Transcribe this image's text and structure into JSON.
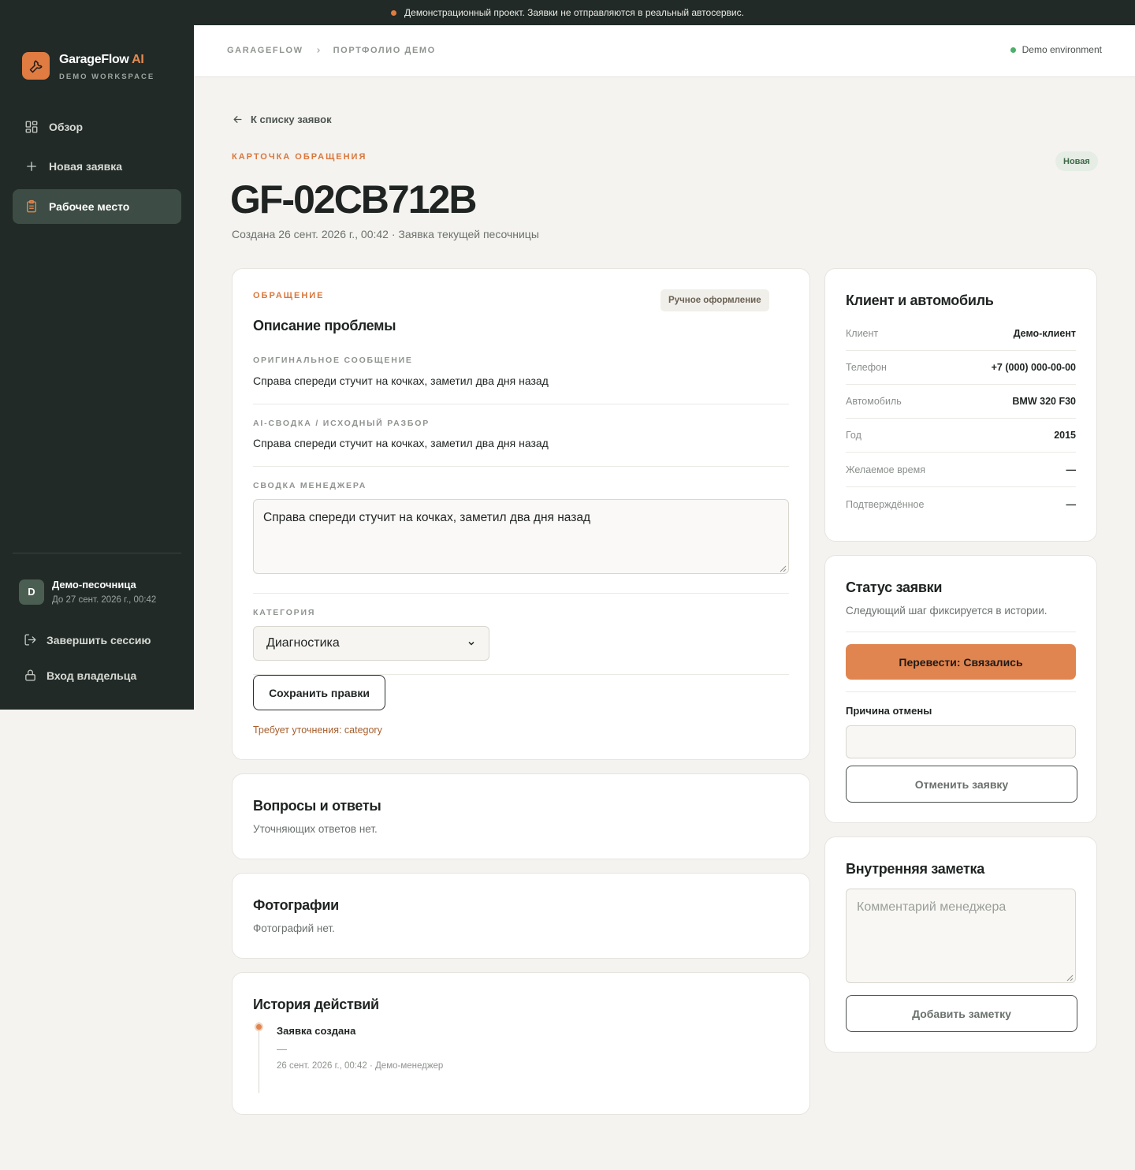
{
  "banner": {
    "text": "Демонстрационный проект. Заявки не отправляются в реальный автосервис."
  },
  "brand": {
    "name": "GarageFlow",
    "name_ai": "AI",
    "subtitle": "DEMO WORKSPACE",
    "icon": "wrench-icon"
  },
  "nav": {
    "overview": "Обзор",
    "new_request": "Новая заявка",
    "workspace": "Рабочее место"
  },
  "user": {
    "initial": "D",
    "name": "Демо-песочница",
    "expires": "До 27 сент. 2026 г., 00:42",
    "end_session": "Завершить сессию",
    "owner_login": "Вход владельца"
  },
  "breadcrumb": {
    "root": "GARAGEFLOW",
    "current": "ПОРТФОЛИО ДЕМО"
  },
  "environment": {
    "label": "Demo environment",
    "color": "#4caf6a"
  },
  "back_link": "К списку заявок",
  "page": {
    "eyebrow": "КАРТОЧКА ОБРАЩЕНИЯ",
    "id": "GF-02CB712B",
    "meta": "Создана 26 сент. 2026 г., 00:42 · Заявка текущей песочницы",
    "status_badge": "Новая"
  },
  "request": {
    "eyebrow": "ОБРАЩЕНИЕ",
    "badge": "Ручное оформление",
    "title": "Описание проблемы",
    "original_label": "ОРИГИНАЛЬНОЕ СООБЩЕНИЕ",
    "original_text": "Справа спереди стучит на кочках, заметил два дня назад",
    "ai_label": "AI-СВОДКА / ИСХОДНЫЙ РАЗБОР",
    "ai_text": "Справа спереди стучит на кочках, заметил два дня назад",
    "manager_label": "СВОДКА МЕНЕДЖЕРА",
    "manager_text": "Справа спереди стучит на кочках, заметил два дня назад",
    "category_label": "КАТЕГОРИЯ",
    "category_value": "Диагностика",
    "save_label": "Сохранить правки",
    "warning": "Требует уточнения: category"
  },
  "qa": {
    "title": "Вопросы и ответы",
    "empty": "Уточняющих ответов нет."
  },
  "photos": {
    "title": "Фотографии",
    "empty": "Фотографий нет."
  },
  "history": {
    "title": "История действий",
    "items": [
      {
        "title": "Заявка создана",
        "detail": "—",
        "meta": "26 сент. 2026 г., 00:42 · Демо-менеджер"
      }
    ]
  },
  "client": {
    "title": "Клиент и автомобиль",
    "rows": [
      {
        "key": "Клиент",
        "value": "Демо-клиент"
      },
      {
        "key": "Телефон",
        "value": "+7 (000) 000-00-00"
      },
      {
        "key": "Автомобиль",
        "value": "BMW 320 F30"
      },
      {
        "key": "Год",
        "value": "2015"
      },
      {
        "key": "Желаемое время",
        "value": "—"
      },
      {
        "key": "Подтверждённое",
        "value": "—"
      }
    ]
  },
  "status": {
    "title": "Статус заявки",
    "subtitle": "Следующий шаг фиксируется в истории.",
    "advance_label": "Перевести: Связались",
    "cancel_reason_label": "Причина отмены",
    "cancel_label": "Отменить заявку",
    "accent": "#e08550"
  },
  "note": {
    "title": "Внутренняя заметка",
    "placeholder": "Комментарий менеджера",
    "add_label": "Добавить заметку"
  }
}
